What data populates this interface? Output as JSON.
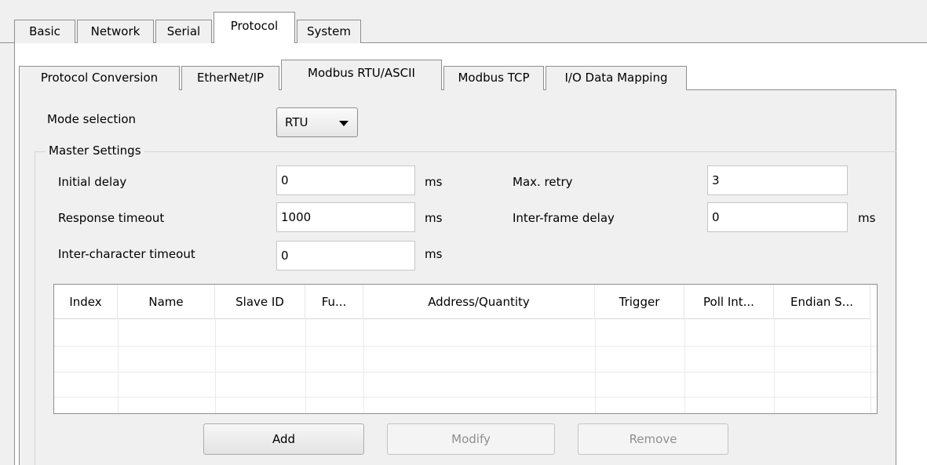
{
  "top_tabs": [
    "Basic",
    "Network",
    "Serial",
    "Protocol",
    "System"
  ],
  "sub_tabs": [
    "Protocol Conversion",
    "EtherNet/IP",
    "Modbus RTU/ASCII",
    "Modbus TCP",
    "I/O Data Mapping"
  ],
  "mode": {
    "label": "Mode selection",
    "value": "RTU"
  },
  "master": {
    "title": "Master Settings",
    "initial_delay": {
      "label": "Initial delay",
      "value": "0",
      "unit": "ms"
    },
    "response_timeout": {
      "label": "Response timeout",
      "value": "1000",
      "unit": "ms"
    },
    "inter_char_timeout": {
      "label": "Inter-character timeout",
      "value": "0",
      "unit": "ms"
    },
    "max_retry": {
      "label": "Max. retry",
      "value": "3"
    },
    "inter_frame_delay": {
      "label": "Inter-frame delay",
      "value": "0",
      "unit": "ms"
    }
  },
  "table": {
    "columns": [
      "Index",
      "Name",
      "Slave ID",
      "Fu...",
      "Address/Quantity",
      "Trigger",
      "Poll Int...",
      "Endian S..."
    ],
    "rows": []
  },
  "buttons": {
    "add": "Add",
    "modify": "Modify",
    "remove": "Remove"
  }
}
